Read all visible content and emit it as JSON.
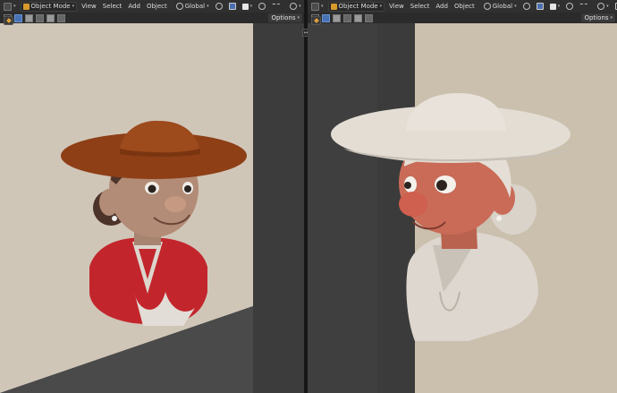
{
  "left_header": {
    "mode": "Object Mode",
    "menus": [
      "View",
      "Select",
      "Add",
      "Object"
    ],
    "transform_orientation": "Global",
    "options_label": "Options"
  },
  "right_header": {
    "mode": "Object Mode",
    "menus": [
      "View",
      "Select",
      "Add",
      "Object"
    ],
    "transform_orientation": "Global",
    "options_label": "Options"
  },
  "colors": {
    "header": "#303030",
    "viewport_bg": "#434343",
    "left_wall": "#cfc5b6",
    "right_wall": "#c9bba8",
    "hat_left": "#9d4a1d",
    "jacket_left": "#c2262c",
    "hat_right": "#e3ddd4",
    "skin_right": "#c96b57"
  },
  "icons": [
    "editor-type-icon",
    "object-mode-icon",
    "orientation-icon",
    "snap-icon",
    "overlay-icon",
    "shading-icon",
    "options-chevron-icon",
    "divider-arrows-icon"
  ]
}
